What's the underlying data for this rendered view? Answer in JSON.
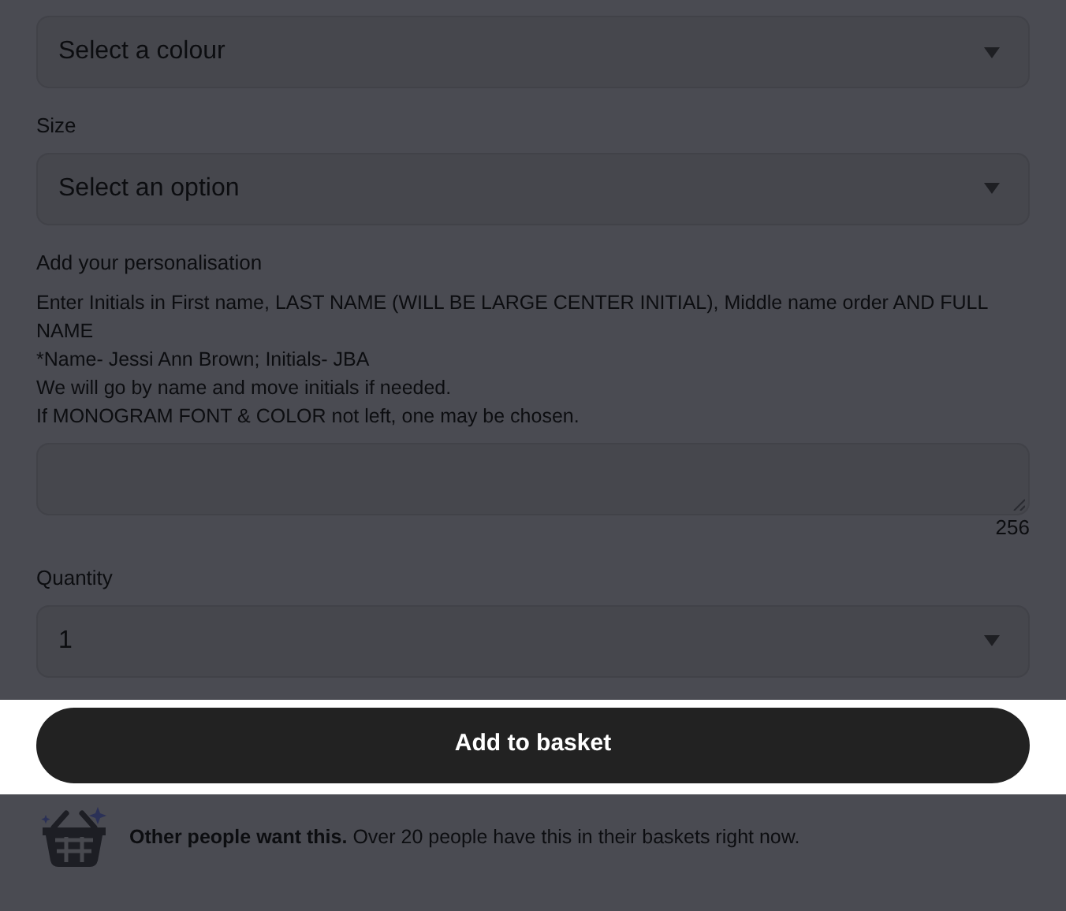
{
  "fields": [
    {
      "kind": "select",
      "value": "Select a colour"
    },
    {
      "kind": "select",
      "label": "Size",
      "value": "Select an option"
    },
    {
      "kind": "textarea",
      "label": "Add your personalisation",
      "instructions": [
        "Enter Initials in First name, LAST NAME (WILL BE LARGE CENTER INITIAL), Middle name order AND FULL NAME",
        "*Name- Jessi Ann Brown; Initials- JBA",
        "We will go by name and move initials if needed.",
        "If MONOGRAM FONT & COLOR not left, one may be chosen."
      ],
      "counter": "256"
    },
    {
      "kind": "select",
      "label": "Quantity",
      "value": "1"
    }
  ],
  "add_button": "Add to basket",
  "notice": "**Other people want this.** Over 20 people have this in their baskets right now."
}
